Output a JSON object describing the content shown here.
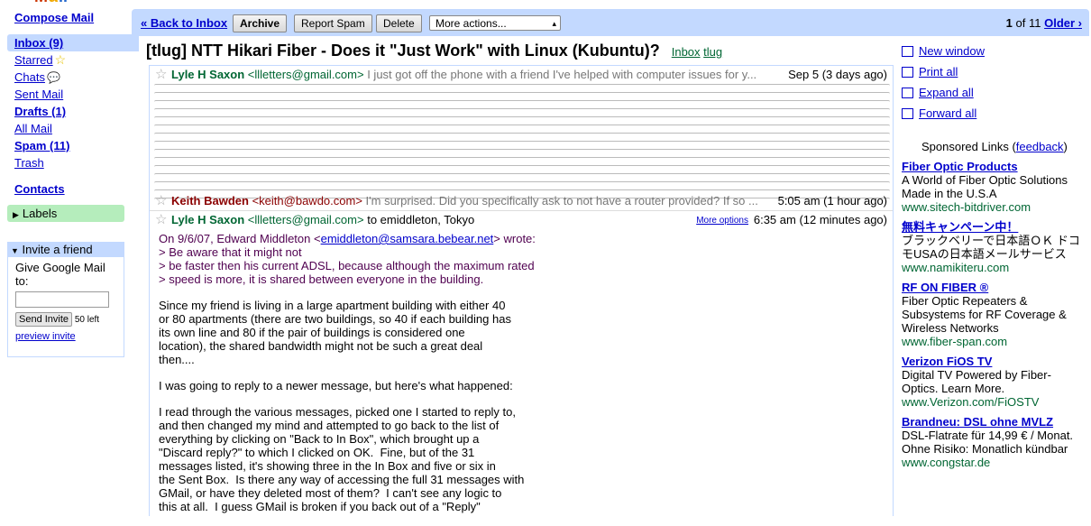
{
  "sidebar": {
    "compose": "Compose Mail",
    "items": [
      {
        "label": "Inbox (9)"
      },
      {
        "label": "Starred"
      },
      {
        "label": "Chats"
      },
      {
        "label": "Sent Mail"
      },
      {
        "label": "Drafts (1)"
      },
      {
        "label": "All Mail"
      },
      {
        "label": "Spam (11)"
      },
      {
        "label": "Trash"
      }
    ],
    "contacts": "Contacts",
    "labels": "Labels",
    "invite": {
      "title": "Invite a friend",
      "prompt": "Give Google Mail to:",
      "send_label": "Send Invite",
      "left": "50 left",
      "preview": "preview invite"
    }
  },
  "toolbar": {
    "back": "« Back to Inbox",
    "archive": "Archive",
    "spam": "Report Spam",
    "delete": "Delete",
    "more": "More actions...",
    "pager_pos": "1",
    "pager_of": "of 11",
    "older": "Older ›"
  },
  "subject": {
    "title": "[tlug] NTT Hikari Fiber - Does it \"Just Work\" with Linux (Kubuntu)?",
    "label1": "Inbox",
    "label2": "tlug"
  },
  "messages": [
    {
      "from": "Lyle H Saxon",
      "email": "<llletters@gmail.com>",
      "snippet": "I just got off the phone with a friend I've helped with computer issues for y...",
      "date": "Sep 5 (3 days ago)"
    },
    {
      "from": "Keith Bawden",
      "email": "<keith@bawdo.com>",
      "snippet": "I'm surprised. Did you specifically ask to not have a router provided? If so ...",
      "date": "5:05 am (1 hour ago)"
    },
    {
      "from": "Lyle H Saxon",
      "email": "<llletters@gmail.com>",
      "to": "to emiddleton, Tokyo",
      "more_options": "More options",
      "date": "6:35 am (12 minutes ago)"
    }
  ],
  "body": {
    "q_intro_a": "On 9/6/07, Edward Middleton <",
    "q_intro_link": "emiddleton@samsara.bebear.net",
    "q_intro_b": "> wrote:",
    "q1": "> Be aware that it might not",
    "q2": "> be faster then his current ADSL, because although the maximum rated",
    "q3": "> speed is more, it is shared between everyone in the building.",
    "p1": "Since my friend is living in a large apartment building with either 40\nor 80 apartments (there are two buildings, so 40 if each building has\nits own line and 80 if the pair of buildings is considered one\nlocation), the shared bandwidth might not be such a great deal\nthen....",
    "p2": "I was going to reply to a newer message, but here's what happened:",
    "p3": "I read through the various messages, picked one I started to reply to,\nand then changed my mind and attempted to go back to the list of\neverything by clicking on \"Back to In Box\", which brought up a\n\"Discard reply?\" to which I clicked on OK.  Fine, but of the 31\nmessages listed, it's showing three in the In Box and five or six in\nthe Sent Box.  Is there any way of accessing the full 31 messages with\nGMail, or have they deleted most of them?  I can't see any logic to\nthis at all.  I guess GMail is broken if you back out of a \"Reply\""
  },
  "actions": {
    "new_window": "New window",
    "print_all": "Print all",
    "expand_all": "Expand all",
    "forward_all": "Forward all"
  },
  "sponsored": {
    "label": "Sponsored Links (",
    "feedback": "feedback",
    "close": ")",
    "ads": [
      {
        "title": "Fiber Optic Products",
        "text": "A World of Fiber Optic Solutions Made in the U.S.A",
        "url": "www.sitech-bitdriver.com"
      },
      {
        "title": "無料キャンペーン中！",
        "text": "ブラックベリーで日本語ＯＫ ドコモUSAの日本語メールサービス",
        "url": "www.namikiteru.com"
      },
      {
        "title": "RF ON FIBER ®",
        "text": "Fiber Optic Repeaters & Subsystems for RF Coverage & Wireless Networks",
        "url": "www.fiber-span.com"
      },
      {
        "title": "Verizon FiOS TV",
        "text": "Digital TV Powered by Fiber-Optics. Learn More.",
        "url": "www.Verizon.com/FiOSTV"
      },
      {
        "title": "Brandneu: DSL ohne MVLZ",
        "text": "DSL-Flatrate für 14,99 € / Monat. Ohne Risiko: Monatlich kündbar",
        "url": "www.congstar.de"
      }
    ]
  }
}
